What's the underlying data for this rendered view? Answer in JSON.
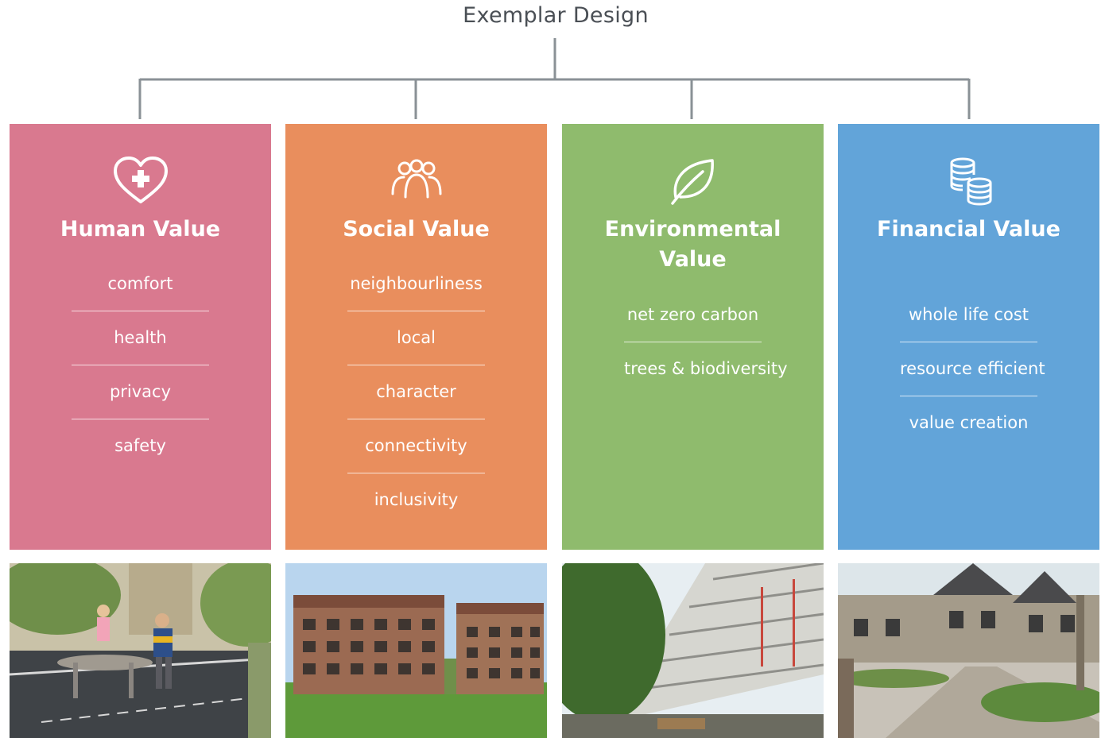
{
  "title": "Exemplar Design",
  "colors": {
    "human": "#d9798f",
    "social": "#e98e5d",
    "environmental": "#8fbb6d",
    "financial": "#62a4d9",
    "connector": "#8a9196"
  },
  "pillars": [
    {
      "icon": "heart-plus-icon",
      "heading": "Human Value",
      "items": [
        "comfort",
        "health",
        "privacy",
        "safety"
      ]
    },
    {
      "icon": "people-icon",
      "heading": "Social Value",
      "items": [
        "neighbourliness",
        "local",
        "character",
        "connectivity",
        "inclusivity"
      ]
    },
    {
      "icon": "leaf-icon",
      "heading": "Environmental Value",
      "items": [
        "net zero carbon",
        "trees & biodiversity"
      ]
    },
    {
      "icon": "coins-icon",
      "heading": "Financial Value",
      "items": [
        "whole life cost",
        "resource efficient",
        "value creation"
      ]
    }
  ],
  "photos": [
    "street-play-photo",
    "apartment-blocks-photo",
    "balcony-facade-photo",
    "mews-housing-photo"
  ]
}
